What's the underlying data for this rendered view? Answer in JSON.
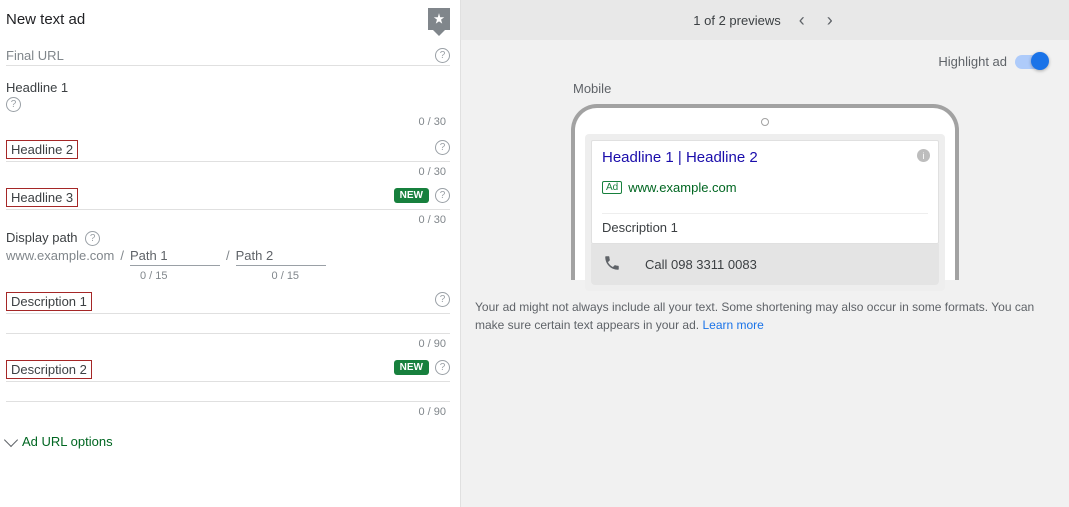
{
  "left": {
    "title": "New text ad",
    "finalUrl": {
      "label": "Final URL"
    },
    "headlines": [
      {
        "label": "Headline 1",
        "counter": "0 / 30",
        "active": true
      },
      {
        "label": "Headline 2",
        "counter": "0 / 30"
      },
      {
        "label": "Headline 3",
        "counter": "0 / 30",
        "badge": "NEW"
      }
    ],
    "displayPath": {
      "label": "Display path",
      "base": "www.example.com",
      "sep": "/",
      "p1": "Path 1",
      "p2": "Path 2",
      "c1": "0 / 15",
      "c2": "0 / 15"
    },
    "descriptions": [
      {
        "label": "Description 1",
        "counter": "0 / 90"
      },
      {
        "label": "Description 2",
        "counter": "0 / 90",
        "badge": "NEW"
      }
    ],
    "adUrlOptions": "Ad URL options"
  },
  "right": {
    "previewLabel": "1 of 2 previews",
    "highlight": "Highlight ad",
    "mobile": "Mobile",
    "ad": {
      "headline": "Headline 1 | Headline 2",
      "tag": "Ad",
      "url": "www.example.com",
      "desc": "Description 1",
      "call": "Call 098 3311 0083"
    },
    "disclaimer": "Your ad might not always include all your text. Some shortening may also occur in some formats. You can make sure certain text appears in your ad.",
    "learn": "Learn more"
  }
}
